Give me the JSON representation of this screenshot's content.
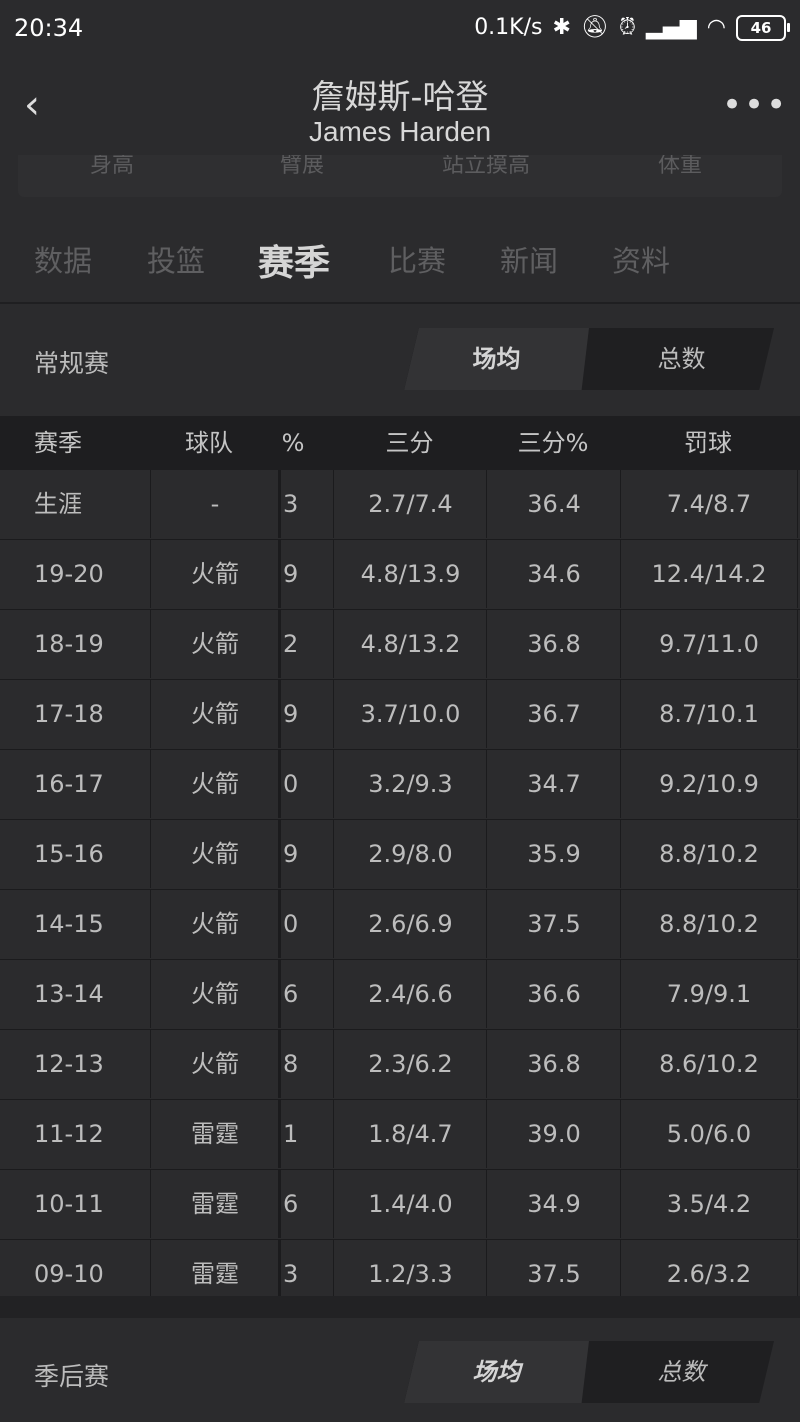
{
  "status": {
    "time": "20:34",
    "net_speed": "0.1K/s",
    "battery": "46"
  },
  "header": {
    "title_cn": "詹姆斯-哈登",
    "title_en": "James Harden"
  },
  "info_labels": [
    "身高",
    "臂展",
    "站立摸高",
    "体重"
  ],
  "tabs": [
    {
      "label": "数据"
    },
    {
      "label": "投篮"
    },
    {
      "label": "赛季",
      "active": true
    },
    {
      "label": "比赛"
    },
    {
      "label": "新闻"
    },
    {
      "label": "资料"
    }
  ],
  "regular": {
    "label": "常规赛",
    "toggle_left": "场均",
    "toggle_right": "总数"
  },
  "playoffs": {
    "label": "季后赛",
    "toggle_left": "场均",
    "toggle_right": "总数"
  },
  "table": {
    "headers": [
      "赛季",
      "球队",
      "%",
      "三分",
      "三分%",
      "罚球"
    ],
    "rows": [
      [
        "生涯",
        "-",
        "3",
        "2.7/7.4",
        "36.4",
        "7.4/8.7"
      ],
      [
        "19-20",
        "火箭",
        "9",
        "4.8/13.9",
        "34.6",
        "12.4/14.2"
      ],
      [
        "18-19",
        "火箭",
        "2",
        "4.8/13.2",
        "36.8",
        "9.7/11.0"
      ],
      [
        "17-18",
        "火箭",
        "9",
        "3.7/10.0",
        "36.7",
        "8.7/10.1"
      ],
      [
        "16-17",
        "火箭",
        "0",
        "3.2/9.3",
        "34.7",
        "9.2/10.9"
      ],
      [
        "15-16",
        "火箭",
        "9",
        "2.9/8.0",
        "35.9",
        "8.8/10.2"
      ],
      [
        "14-15",
        "火箭",
        "0",
        "2.6/6.9",
        "37.5",
        "8.8/10.2"
      ],
      [
        "13-14",
        "火箭",
        "6",
        "2.4/6.6",
        "36.6",
        "7.9/9.1"
      ],
      [
        "12-13",
        "火箭",
        "8",
        "2.3/6.2",
        "36.8",
        "8.6/10.2"
      ],
      [
        "11-12",
        "雷霆",
        "1",
        "1.8/4.7",
        "39.0",
        "5.0/6.0"
      ],
      [
        "10-11",
        "雷霆",
        "6",
        "1.4/4.0",
        "34.9",
        "3.5/4.2"
      ],
      [
        "09-10",
        "雷霆",
        "3",
        "1.2/3.3",
        "37.5",
        "2.6/3.2"
      ]
    ]
  }
}
